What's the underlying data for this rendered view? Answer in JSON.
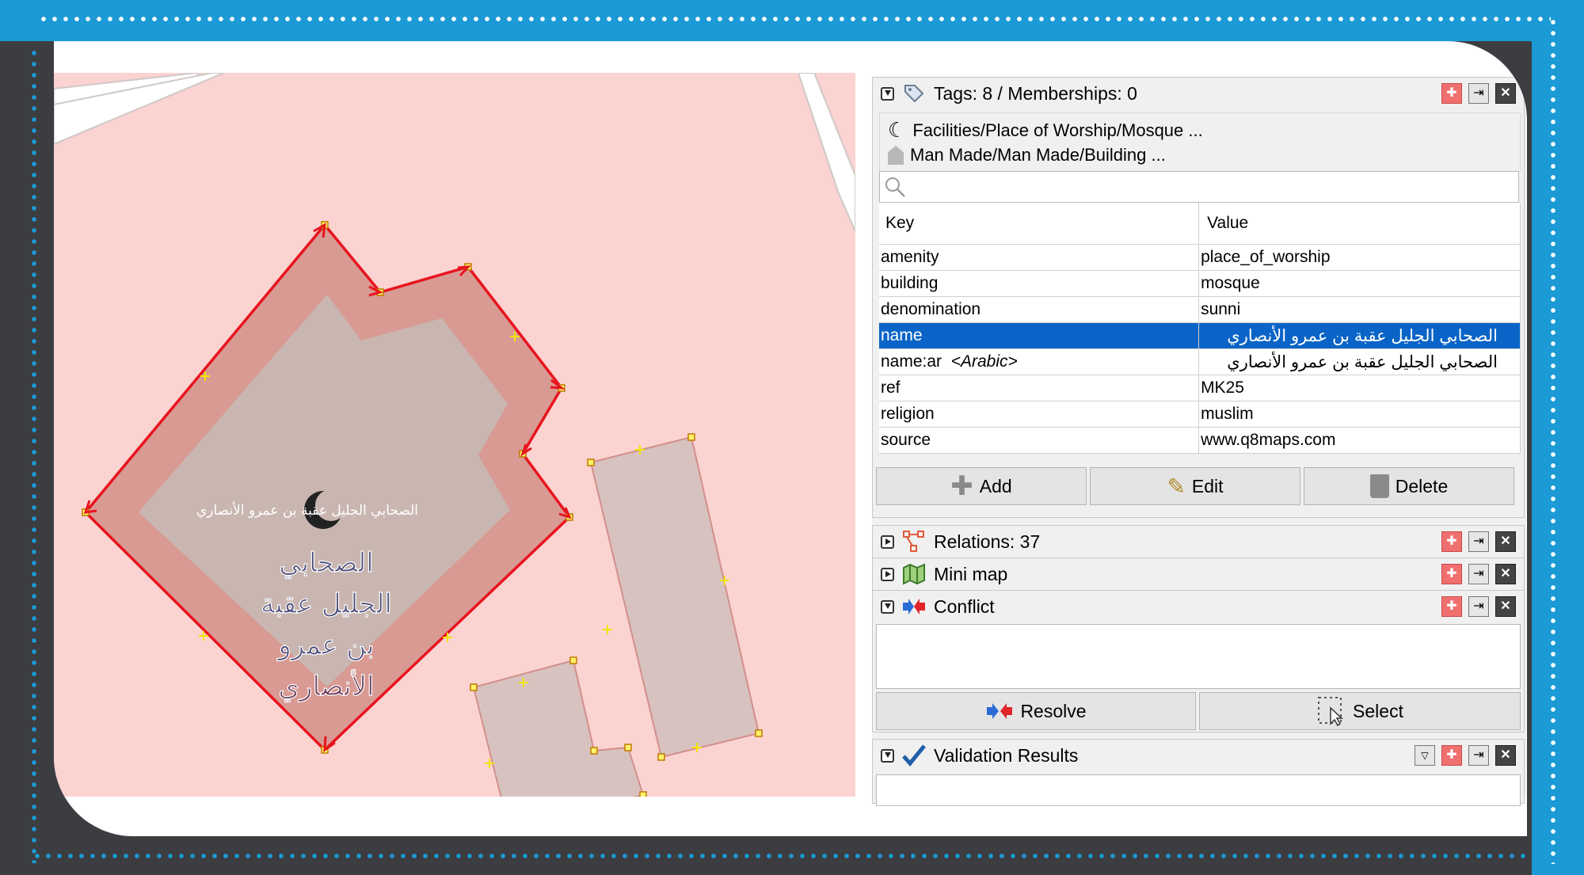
{
  "map": {
    "label_small": "الصحابي الجليل عقبة بن عمرو الأنصاري",
    "label_large": [
      "الصحابي",
      "الجليل عقبة",
      "بن عمرو",
      "الأنصاري"
    ]
  },
  "tags_panel": {
    "title": "Tags: 8 / Memberships: 0",
    "presets": [
      {
        "label": "Facilities/Place of Worship/Mosque ...",
        "icon": "crescent-icon"
      },
      {
        "label": "Man Made/Man Made/Building ...",
        "icon": "building-icon"
      }
    ],
    "search_placeholder": "",
    "columns": {
      "key": "Key",
      "value": "Value"
    },
    "rows": [
      {
        "key": "amenity",
        "value": "place_of_worship"
      },
      {
        "key": "building",
        "value": "mosque"
      },
      {
        "key": "denomination",
        "value": "sunni"
      },
      {
        "key": "name",
        "value": "الصحابي الجليل عقبة بن عمرو الأنصاري"
      },
      {
        "key": "name:ar",
        "key_hint": "<Arabic>",
        "value": "الصحابي الجليل عقبة بن عمرو الأنصاري"
      },
      {
        "key": "ref",
        "value": "MK25"
      },
      {
        "key": "religion",
        "value": "muslim"
      },
      {
        "key": "source",
        "value": "www.q8maps.com"
      }
    ],
    "selected_row": "name",
    "buttons": {
      "add": "Add",
      "edit": "Edit",
      "delete": "Delete"
    }
  },
  "relations_panel": {
    "title": "Relations: 37",
    "expanded": false
  },
  "minimap_panel": {
    "title": "Mini map",
    "expanded": false
  },
  "conflict_panel": {
    "title": "Conflict",
    "expanded": true,
    "buttons": {
      "resolve": "Resolve",
      "select": "Select"
    }
  },
  "validation_panel": {
    "title": "Validation Results",
    "expanded": true
  },
  "colors": {
    "frame": "#1b9ad6",
    "selection": "#0a64c7",
    "map_bg": "#fbd3d1",
    "way": "#e8141e"
  }
}
